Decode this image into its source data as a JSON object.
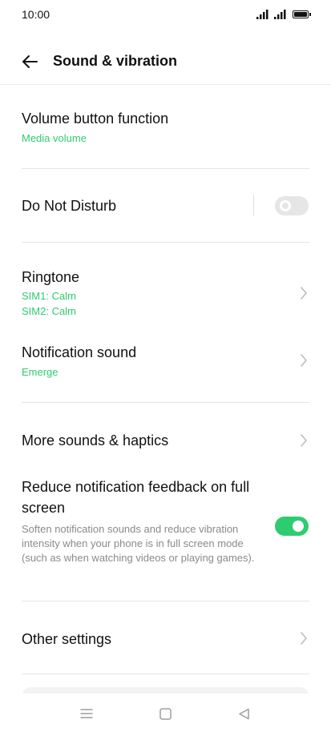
{
  "status_bar": {
    "time": "10:00"
  },
  "header": {
    "title": "Sound & vibration"
  },
  "settings": {
    "volume_button": {
      "label": "Volume button function",
      "value": "Media volume"
    },
    "dnd": {
      "label": "Do Not Disturb",
      "enabled": false
    },
    "ringtone": {
      "label": "Ringtone",
      "sim1": "SIM1: Calm",
      "sim2": "SIM2: Calm"
    },
    "notification_sound": {
      "label": "Notification sound",
      "value": "Emerge"
    },
    "more_sounds": {
      "label": "More sounds & haptics"
    },
    "reduce_feedback": {
      "label": "Reduce notification feedback on full screen",
      "description": "Soften notification sounds and reduce vibration intensity when your phone is in full screen mode (such as when watching videos or playing games).",
      "enabled": true
    },
    "other_settings": {
      "label": "Other settings"
    }
  },
  "colors": {
    "accent": "#2ecc71",
    "toggle_off": "#e6e6e6",
    "secondary_text": "#8a8a8a"
  }
}
